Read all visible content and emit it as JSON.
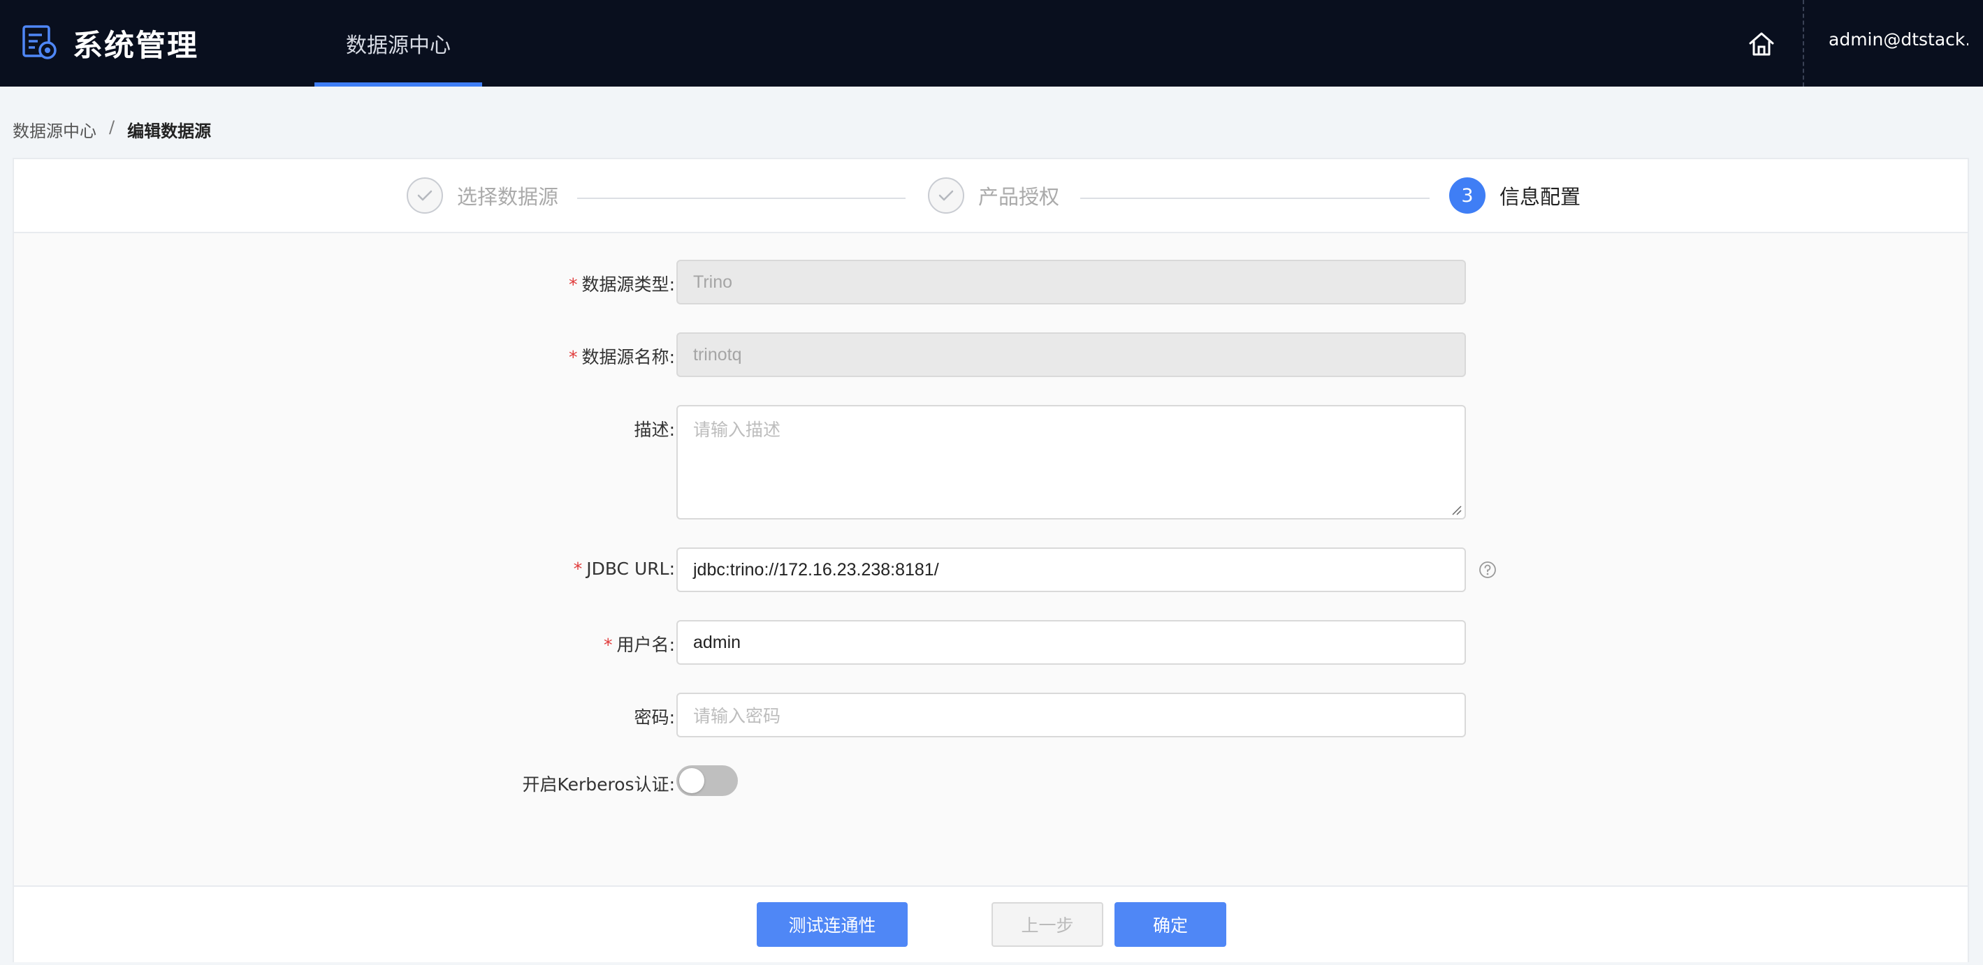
{
  "app": {
    "title": "系统管理",
    "nav_tab": "数据源中心",
    "user": "admin@dtstack...."
  },
  "breadcrumb": {
    "items": [
      "数据源中心"
    ],
    "separator": "/",
    "current": "编辑数据源"
  },
  "steps": [
    {
      "label": "选择数据源",
      "status": "done"
    },
    {
      "label": "产品授权",
      "status": "done"
    },
    {
      "label": "信息配置",
      "status": "active",
      "number": "3"
    }
  ],
  "form": {
    "type": {
      "label": "数据源类型",
      "value": "Trino",
      "required": true,
      "disabled": true
    },
    "name": {
      "label": "数据源名称",
      "value": "trinotq",
      "required": true,
      "disabled": true
    },
    "description": {
      "label": "描述",
      "value": "",
      "placeholder": "请输入描述"
    },
    "jdbc_url": {
      "label": "JDBC URL",
      "value": "jdbc:trino://172.16.23.238:8181/",
      "required": true
    },
    "username": {
      "label": "用户名",
      "value": "admin",
      "required": true
    },
    "password": {
      "label": "密码",
      "value": "",
      "placeholder": "请输入密码"
    },
    "kerberos": {
      "label": "开启Kerberos认证",
      "enabled": false
    },
    "colon": ":"
  },
  "footer": {
    "test_button": "测试连通性",
    "prev_button": "上一步",
    "confirm_button": "确定"
  },
  "colors": {
    "topbar_bg": "#090f1e",
    "accent": "#3f7ef5",
    "required": "#e03a3a"
  },
  "icons": [
    "settings-app-icon",
    "home-icon",
    "check-icon",
    "help-icon",
    "resize-grip-icon"
  ]
}
